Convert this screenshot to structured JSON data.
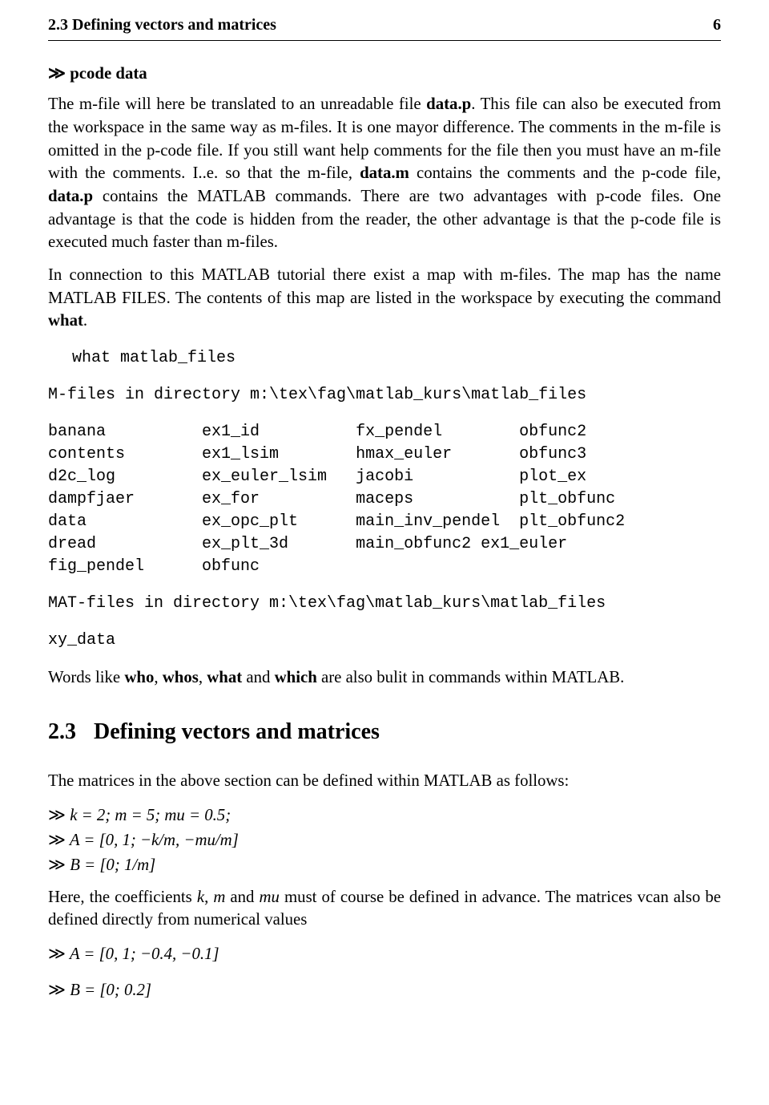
{
  "header": {
    "section": "2.3 Defining vectors and matrices",
    "page_no": "6"
  },
  "cmd1": {
    "prompt": "≫",
    "text": "pcode data"
  },
  "para1": {
    "a": "The m-file will here be translated to an unreadable file ",
    "b": "data.p",
    "c": ". This file can also be executed from the workspace in the same way as m-files. It is one mayor difference. The comments in the m-file is omitted in the p-code file. If you still want help comments for the file then you must have an m-file with the comments. I..e. so that the m-file, ",
    "d": "data.m",
    "e": " contains the comments and the p-code file, ",
    "f": "data.p",
    "g": " contains the MATLAB commands. There are two advantages with p-code files. One advantage is that the code is hidden from the reader, the other advantage is that the p-code file is executed much faster than m-files."
  },
  "para2": {
    "a": "In connection to this MATLAB tutorial there exist a map with m-files. The map has the name MATLAB FILES. The contents of this map are listed in the workspace by executing the command ",
    "b": "what",
    "c": "."
  },
  "code": {
    "cmd": " what matlab_files",
    "out1": "M-files in directory m:\\tex\\fag\\matlab_kurs\\matlab_files",
    "table": "banana          ex1_id          fx_pendel        obfunc2\ncontents        ex1_lsim        hmax_euler       obfunc3\nd2c_log         ex_euler_lsim   jacobi           plot_ex\ndampfjaer       ex_for          maceps           plt_obfunc\ndata            ex_opc_plt      main_inv_pendel  plt_obfunc2\ndread           ex_plt_3d       main_obfunc2 ex1_euler\nfig_pendel      obfunc",
    "out2": "MAT-files in directory m:\\tex\\fag\\matlab_kurs\\matlab_files",
    "out3": "xy_data"
  },
  "para3": {
    "a": "Words like ",
    "b": "who",
    "c": ", ",
    "d": "whos",
    "e": ", ",
    "f": "what",
    "g": " and ",
    "h": "which",
    "i": " are also bulit in commands within MATLAB."
  },
  "section": {
    "num": "2.3",
    "title": "Defining vectors and matrices"
  },
  "para4": "The matrices in the above section can be defined within MATLAB as follows:",
  "math1": {
    "l1": "k = 2; m = 5; mu = 0.5;",
    "l2": "A = [0, 1; −k/m, −mu/m]",
    "l3": "B = [0; 1/m]"
  },
  "para5": {
    "a": "Here, the coefficients ",
    "b_k": "k",
    "c": ", ",
    "d_m": "m",
    "e": " and ",
    "f_mu": "mu",
    "g": " must of course be defined in advance. The matrices vcan also be defined directly from numerical values"
  },
  "math2": {
    "l1": "A = [0, 1; −0.4, −0.1]",
    "l2": "B = [0; 0.2]"
  }
}
